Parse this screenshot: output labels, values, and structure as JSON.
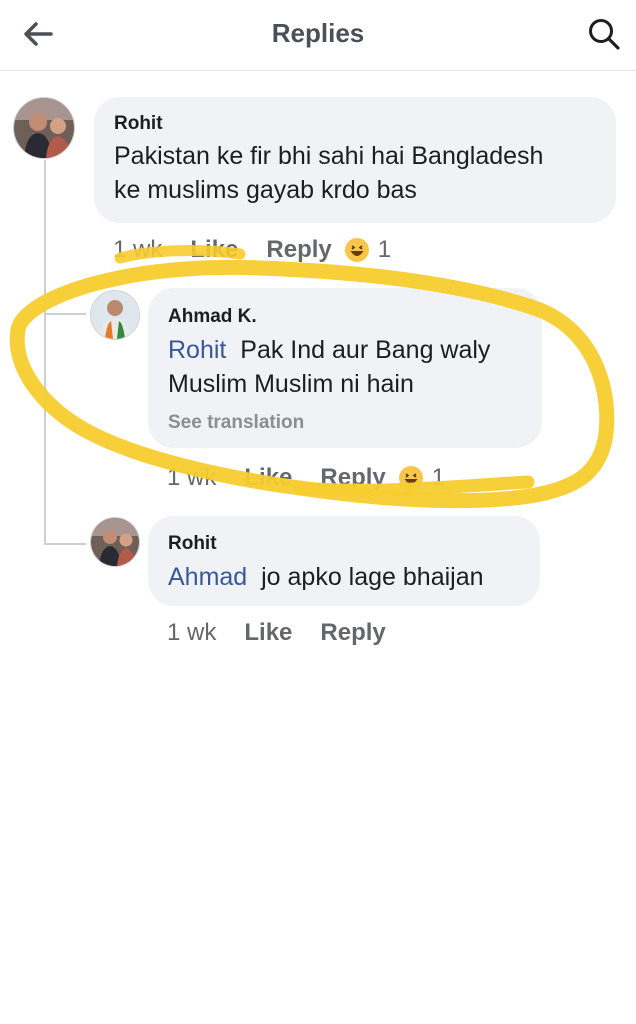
{
  "header": {
    "title": "Replies",
    "back_icon": "back-arrow-icon",
    "search_icon": "search-icon"
  },
  "comments": [
    {
      "author": "Rohit",
      "mention": "",
      "text_line1": "Pakistan ke fir bhi sahi hai Bangladesh",
      "text_line2": "ke muslims gayab krdo bas",
      "time": "1 wk",
      "like_label": "Like",
      "reply_label": "Reply",
      "reaction_emoji": "😄",
      "reaction_count": "1"
    },
    {
      "author": "Ahmad K.",
      "mention": "Rohit",
      "text_line1": "Pak Ind aur Bang waly",
      "text_line2": "Muslim Muslim ni hain",
      "see_translation": "See translation",
      "time": "1 wk",
      "like_label": "Like",
      "reply_label": "Reply",
      "reaction_emoji": "😄",
      "reaction_count": "1"
    },
    {
      "author": "Rohit",
      "mention": "Ahmad",
      "text_line1": "jo apko lage bhaijan",
      "time": "1 wk",
      "like_label": "Like",
      "reply_label": "Reply"
    }
  ],
  "colors": {
    "mention": "#385898",
    "bubble": "#f0f2f5",
    "annotation": "#f7cc2e",
    "meta_text": "#65676b"
  }
}
